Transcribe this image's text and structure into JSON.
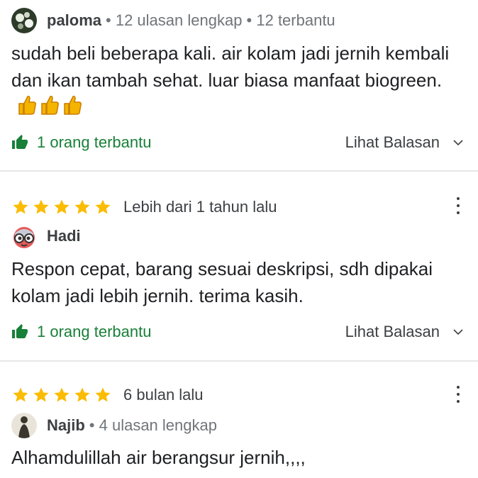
{
  "reviews": [
    {
      "author": "paloma",
      "meta": "• 12 ulasan lengkap • 12 terbantu",
      "text": "sudah beli beberapa kali. air kolam jadi jernih kembali dan ikan tambah sehat. luar biasa manfaat biogreen.",
      "emoji": "👍👍👍",
      "helpful": "1 orang terbantu",
      "replies": "Lihat Balasan"
    },
    {
      "rating": 5,
      "date": "Lebih dari 1 tahun lalu",
      "author": "Hadi",
      "text": "Respon cepat, barang sesuai deskripsi, sdh dipakai kolam jadi lebih jernih. terima kasih.",
      "helpful": "1 orang terbantu",
      "replies": "Lihat Balasan"
    },
    {
      "rating": 5,
      "date": "6 bulan lalu",
      "author": "Najib",
      "meta": "• 4 ulasan lengkap",
      "text": "Alhamdulillah air berangsur jernih,,,,"
    }
  ],
  "colors": {
    "star": "#fbbc04",
    "helpful": "#188038",
    "divider": "#e6e6e6"
  }
}
